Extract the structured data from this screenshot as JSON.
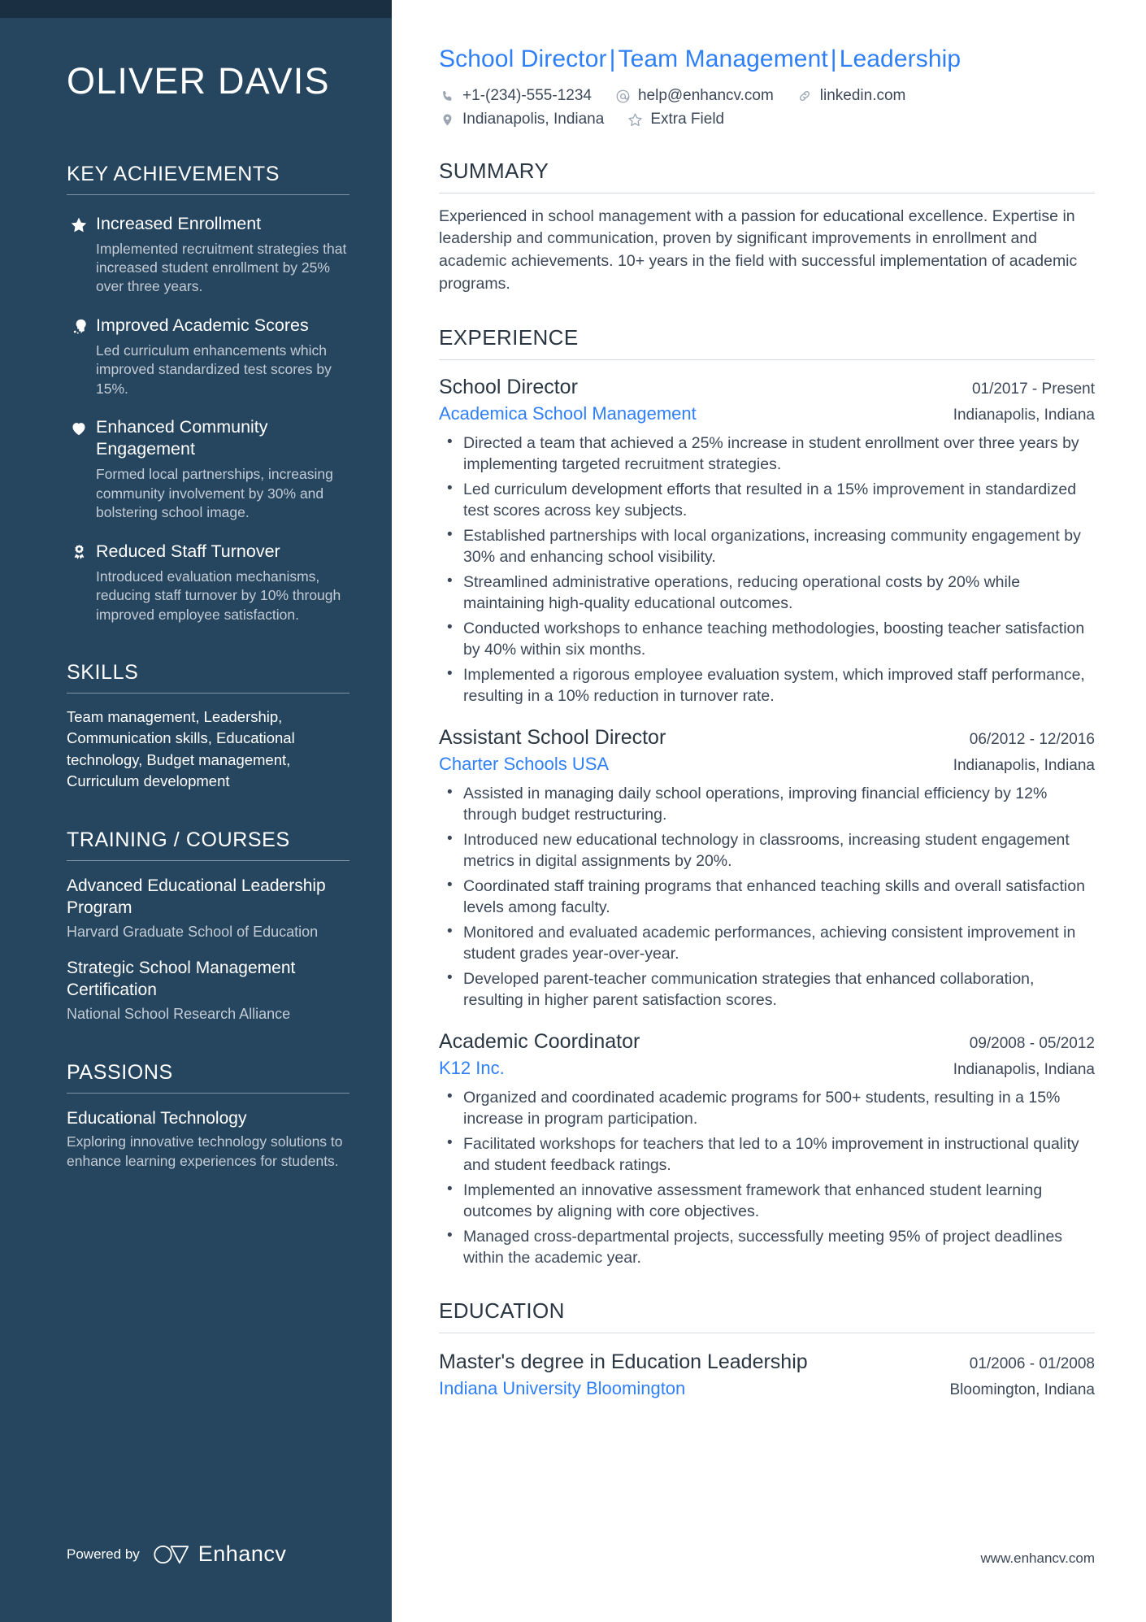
{
  "sidebar": {
    "name": "OLIVER DAVIS",
    "key_achievements": {
      "heading": "KEY ACHIEVEMENTS",
      "items": [
        {
          "icon": "star-icon",
          "title": "Increased Enrollment",
          "description": "Implemented recruitment strategies that increased student enrollment by 25% over three years."
        },
        {
          "icon": "head-idea-icon",
          "title": "Improved Academic Scores",
          "description": "Led curriculum enhancements which improved standardized test scores by 15%."
        },
        {
          "icon": "heart-icon",
          "title": "Enhanced Community Engagement",
          "description": "Formed local partnerships, increasing community involvement by 30% and bolstering school image."
        },
        {
          "icon": "award-ribbon-icon",
          "title": "Reduced Staff Turnover",
          "description": "Introduced evaluation mechanisms, reducing staff turnover by 10% through improved employee satisfaction."
        }
      ]
    },
    "skills": {
      "heading": "SKILLS",
      "text": "Team management, Leadership, Communication skills, Educational technology, Budget management, Curriculum development"
    },
    "training": {
      "heading": "TRAINING / COURSES",
      "items": [
        {
          "title": "Advanced Educational Leadership Program",
          "subtitle": "Harvard Graduate School of Education"
        },
        {
          "title": "Strategic School Management Certification",
          "subtitle": "National School Research Alliance"
        }
      ]
    },
    "passions": {
      "heading": "PASSIONS",
      "items": [
        {
          "title": "Educational Technology",
          "description": "Exploring innovative technology solutions to enhance learning experiences for students."
        }
      ]
    },
    "powered_by": {
      "label": "Powered by",
      "brand": "Enhancv"
    }
  },
  "main": {
    "headline": {
      "part1": "School Director",
      "part2": "Team Management",
      "part3": "Leadership",
      "separator": "|"
    },
    "contacts": {
      "row1": [
        {
          "icon": "phone-icon",
          "value": "+1-(234)-555-1234"
        },
        {
          "icon": "at-email-icon",
          "value": "help@enhancv.com"
        },
        {
          "icon": "link-icon",
          "value": "linkedin.com"
        }
      ],
      "row2": [
        {
          "icon": "location-pin-icon",
          "value": "Indianapolis, Indiana"
        },
        {
          "icon": "star-outline-icon",
          "value": "Extra Field"
        }
      ]
    },
    "summary": {
      "heading": "SUMMARY",
      "text": "Experienced in school management with a passion for educational excellence. Expertise in leadership and communication, proven by significant improvements in enrollment and academic achievements. 10+ years in the field with successful implementation of academic programs."
    },
    "experience": {
      "heading": "EXPERIENCE",
      "jobs": [
        {
          "title": "School Director",
          "dates": "01/2017 - Present",
          "company": "Academica School Management",
          "location": "Indianapolis, Indiana",
          "bullets": [
            "Directed a team that achieved a 25% increase in student enrollment over three years by implementing targeted recruitment strategies.",
            "Led curriculum development efforts that resulted in a 15% improvement in standardized test scores across key subjects.",
            "Established partnerships with local organizations, increasing community engagement by 30% and enhancing school visibility.",
            "Streamlined administrative operations, reducing operational costs by 20% while maintaining high-quality educational outcomes.",
            "Conducted workshops to enhance teaching methodologies, boosting teacher satisfaction by 40% within six months.",
            "Implemented a rigorous employee evaluation system, which improved staff performance, resulting in a 10% reduction in turnover rate."
          ]
        },
        {
          "title": "Assistant School Director",
          "dates": "06/2012 - 12/2016",
          "company": "Charter Schools USA",
          "location": "Indianapolis, Indiana",
          "bullets": [
            "Assisted in managing daily school operations, improving financial efficiency by 12% through budget restructuring.",
            "Introduced new educational technology in classrooms, increasing student engagement metrics in digital assignments by 20%.",
            "Coordinated staff training programs that enhanced teaching skills and overall satisfaction levels among faculty.",
            "Monitored and evaluated academic performances, achieving consistent improvement in student grades year-over-year.",
            "Developed parent-teacher communication strategies that enhanced collaboration, resulting in higher parent satisfaction scores."
          ]
        },
        {
          "title": "Academic Coordinator",
          "dates": "09/2008 - 05/2012",
          "company": "K12 Inc.",
          "location": "Indianapolis, Indiana",
          "bullets": [
            "Organized and coordinated academic programs for 500+ students, resulting in a 15% increase in program participation.",
            "Facilitated workshops for teachers that led to a 10% improvement in instructional quality and student feedback ratings.",
            "Implemented an innovative assessment framework that enhanced student learning outcomes by aligning with core objectives.",
            "Managed cross-departmental projects, successfully meeting 95% of project deadlines within the academic year."
          ]
        }
      ]
    },
    "education": {
      "heading": "EDUCATION",
      "items": [
        {
          "degree": "Master's degree in Education Leadership",
          "dates": "01/2006 - 01/2008",
          "school": "Indiana University Bloomington",
          "location": "Bloomington, Indiana"
        }
      ]
    },
    "footer_url": "www.enhancv.com"
  },
  "colors": {
    "sidebar_bg": "#26455f",
    "sidebar_band": "#1b2f42",
    "accent_blue": "#2f7ff7",
    "body_text": "#3c4858",
    "heading_text": "#2a3642"
  }
}
